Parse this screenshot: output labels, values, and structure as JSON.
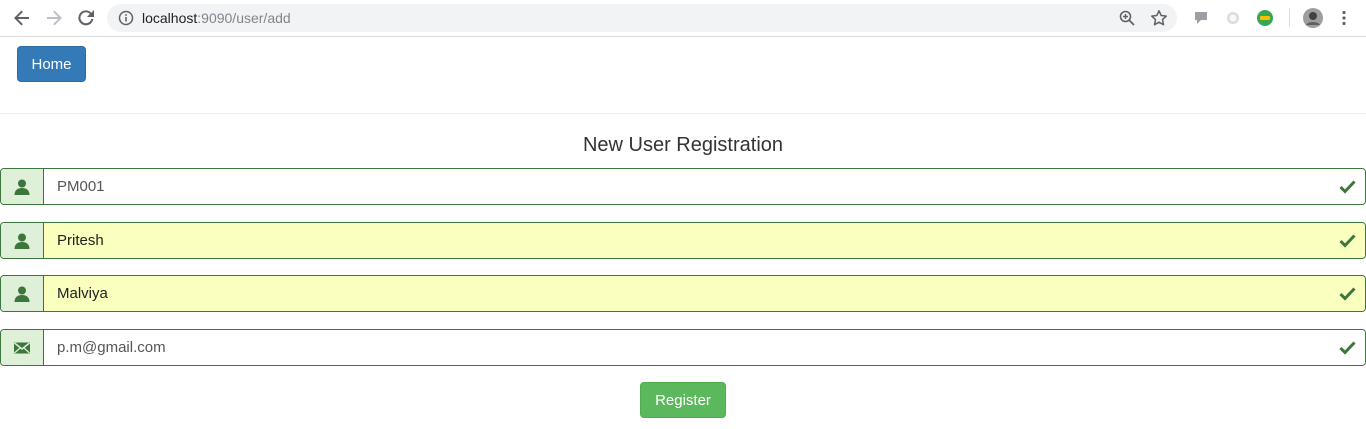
{
  "browser": {
    "url_host": "localhost",
    "url_path": ":9090/user/add",
    "icons": [
      "back-icon",
      "forward-icon",
      "reload-icon",
      "info-icon",
      "zoom-icon",
      "star-icon",
      "extension-icon",
      "profile-avatar",
      "menu-icon"
    ]
  },
  "nav": {
    "home_label": "Home"
  },
  "form": {
    "title": "New User Registration",
    "fields": [
      {
        "icon": "user-icon",
        "value": "PM001",
        "autofill": false
      },
      {
        "icon": "user-icon",
        "value": "Pritesh",
        "autofill": true
      },
      {
        "icon": "user-icon",
        "value": "Malviya",
        "autofill": true
      },
      {
        "icon": "envelope-icon",
        "value": "p.m@gmail.com",
        "autofill": false
      }
    ],
    "register_label": "Register"
  },
  "colors": {
    "primary": "#337ab7",
    "success": "#5cb85c",
    "valid_border": "#3c763d",
    "addon_bg": "#dff0d8",
    "autofill_bg": "#faffbd"
  }
}
